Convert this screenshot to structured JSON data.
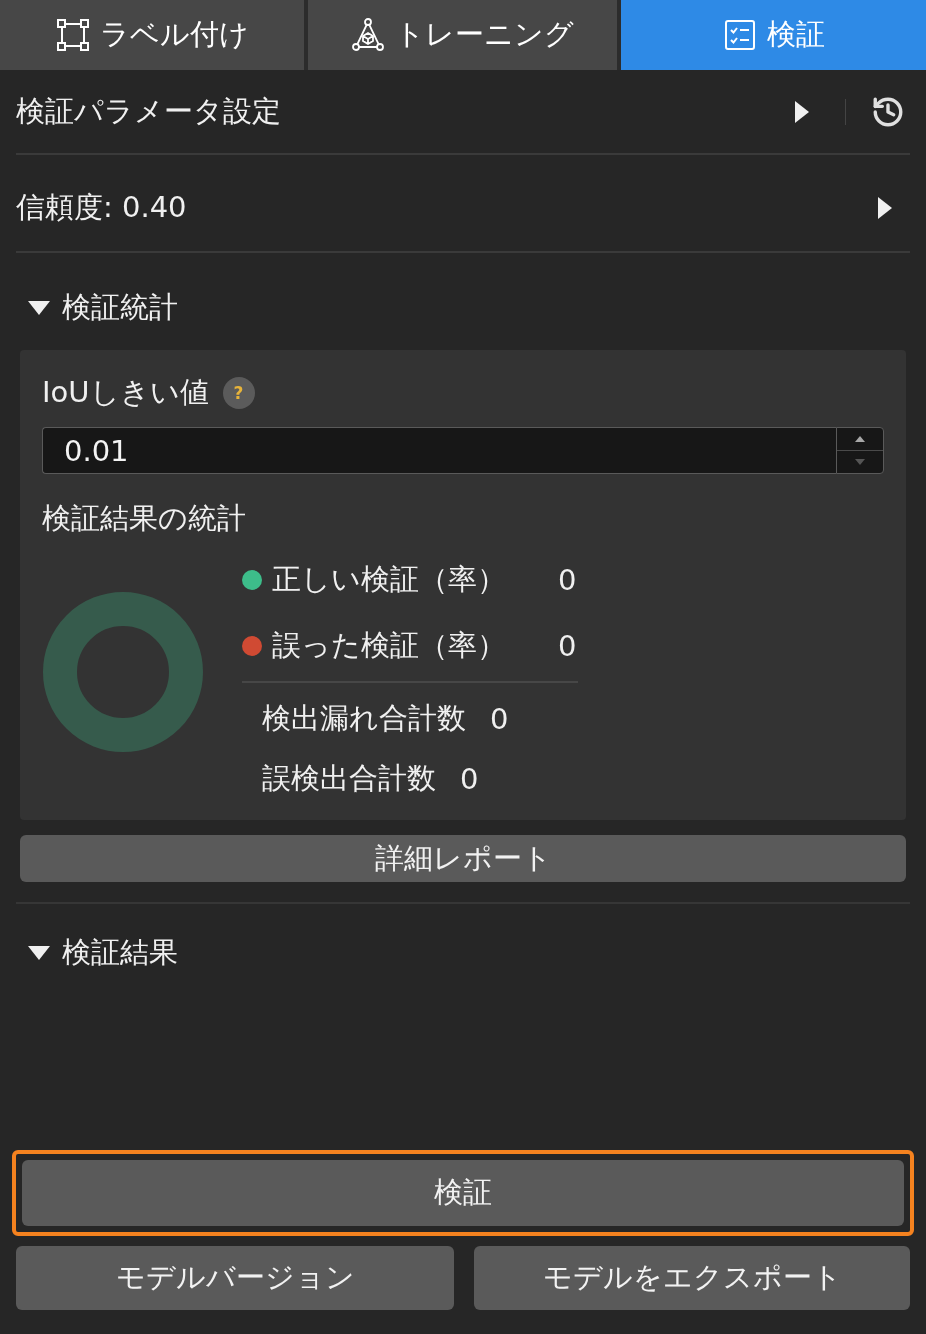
{
  "tabs": [
    {
      "label": "ラベル付け",
      "kind": "labeling",
      "selected": false
    },
    {
      "label": "トレーニング",
      "kind": "training",
      "selected": false
    },
    {
      "label": "検証",
      "kind": "validation",
      "selected": true
    }
  ],
  "settings": {
    "title": "検証パラメータ設定",
    "expanded": false
  },
  "confidence": {
    "label": "信頼度: 0.40",
    "expanded": false
  },
  "statistics": {
    "title": "検証統計",
    "expanded": true,
    "iou": {
      "label": "IoUしきい値",
      "help": "?",
      "value": "0.01"
    },
    "chart_title": "検証結果の統計",
    "legend": [
      {
        "label": "正しい検証（率）",
        "value": "0",
        "color": "#3dbd8a"
      },
      {
        "label": "誤った検証（率）",
        "value": "0",
        "color": "#d04a33"
      }
    ],
    "totals": [
      {
        "label": "検出漏れ合計数",
        "value": "0"
      },
      {
        "label": "誤検出合計数",
        "value": "0"
      }
    ],
    "report_button": "詳細レポート"
  },
  "results": {
    "title": "検証結果",
    "expanded": true
  },
  "actions": {
    "primary": {
      "label": "検証",
      "highlighted": true
    },
    "secondary": [
      "モデルバージョン",
      "モデルをエクスポート"
    ]
  }
}
